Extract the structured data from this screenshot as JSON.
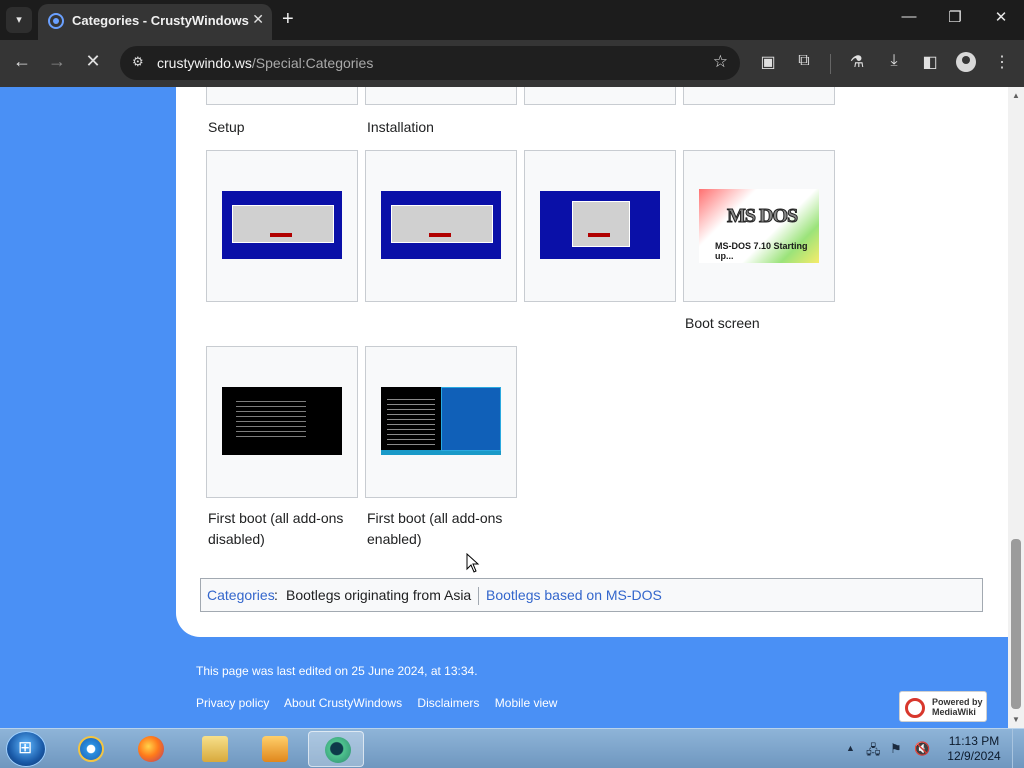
{
  "browser": {
    "tab_title": "Categories - CrustyWindows",
    "tab_menu_icon": "chevron-down-icon",
    "new_tab_icon": "+",
    "url_host": "crustywindo.ws",
    "url_path": "/Special:Categories",
    "minimize": "—",
    "maximize": "❐",
    "close": "✕"
  },
  "gallery": {
    "row0_captions": [
      "Setup",
      "Installation"
    ],
    "row1_captions": [
      "Boot screen"
    ],
    "row2_captions": [
      "First boot (all add-ons disabled)",
      "First boot (all add-ons enabled)"
    ],
    "msdos_logo": "MS DOS",
    "msdos_version": "MS-DOS 7.10 Starting up..."
  },
  "catlinks": {
    "label": "Categories",
    "items": [
      "Bootlegs originating from Asia",
      "Bootlegs based on MS-DOS"
    ]
  },
  "footer": {
    "last_edited": "This page was last edited on 25 June 2024, at 13:34.",
    "links": [
      "Privacy policy",
      "About CrustyWindows",
      "Disclaimers",
      "Mobile view"
    ],
    "powered_by_line1": "Powered by",
    "powered_by_line2": "MediaWiki"
  },
  "taskbar": {
    "time": "11:13 PM",
    "date": "12/9/2024"
  },
  "colors": {
    "page_background": "#4a90f5",
    "link": "#3366cc",
    "chrome_frame": "#1c1c1c",
    "chrome_toolbar": "#353535"
  }
}
